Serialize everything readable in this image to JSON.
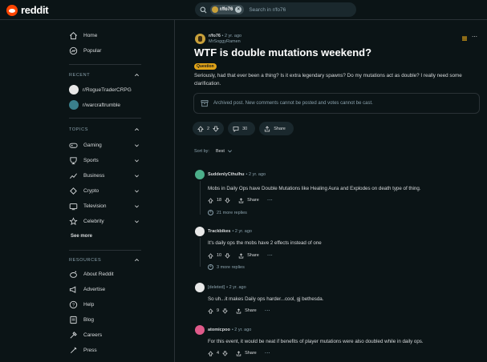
{
  "header": {
    "brand": "reddit",
    "search_chip": "r/fo76",
    "search_placeholder": "Search in r/fo76"
  },
  "sidebar": {
    "nav": [
      {
        "label": "Home",
        "icon": "home-icon"
      },
      {
        "label": "Popular",
        "icon": "popular-icon"
      }
    ],
    "recent_title": "RECENT",
    "recent": [
      {
        "label": "r/RogueTraderCRPG",
        "color": "#e8e8e8"
      },
      {
        "label": "r/warcraftrumble",
        "color": "#3a7f8c"
      }
    ],
    "topics_title": "TOPICS",
    "topics": [
      {
        "label": "Gaming",
        "icon": "gaming-icon"
      },
      {
        "label": "Sports",
        "icon": "sports-icon"
      },
      {
        "label": "Business",
        "icon": "business-icon"
      },
      {
        "label": "Crypto",
        "icon": "crypto-icon"
      },
      {
        "label": "Television",
        "icon": "television-icon"
      },
      {
        "label": "Celebrity",
        "icon": "celebrity-icon"
      }
    ],
    "see_more": "See more",
    "resources_title": "RESOURCES",
    "resources": [
      {
        "label": "About Reddit",
        "icon": "reddit-icon"
      },
      {
        "label": "Advertise",
        "icon": "advertise-icon"
      },
      {
        "label": "Help",
        "icon": "help-icon"
      },
      {
        "label": "Blog",
        "icon": "blog-icon"
      },
      {
        "label": "Careers",
        "icon": "careers-icon"
      },
      {
        "label": "Press",
        "icon": "press-icon"
      }
    ]
  },
  "post": {
    "subreddit": "r/fo76",
    "time": "• 2 yr. ago",
    "author": "MrSoggyRamen",
    "title": "WTF is double mutations weekend?",
    "flair": "Question",
    "body": "Seriously, had that ever been a thing? Is it extra legendary spawns? Do my mutations act as double? I really need some clarification.",
    "archived_note": "Archived post. New comments cannot be posted and votes cannot be cast.",
    "votes": "2",
    "comments": "30",
    "share": "Share"
  },
  "sort": {
    "label": "Sort by:",
    "value": "Best"
  },
  "comments": [
    {
      "author": "SuddenlyCthulhu",
      "time": "• 2 yr. ago",
      "text": "Mobs in Daily Ops have Double Mutations like Healing Aura and Explodes on death type of thing.",
      "votes": "18",
      "share": "Share",
      "more": "21 more replies",
      "avatar_color": "#4caf8a"
    },
    {
      "author": "Trackbikes",
      "time": "• 2 yr. ago",
      "text": "It's daily ops the mobs have 2 effects instead of one",
      "votes": "10",
      "share": "Share",
      "more": "3 more replies",
      "avatar_color": "#e8e8e8"
    },
    {
      "author": "[deleted]",
      "time": "• 2 yr. ago",
      "text": "So uh...it makes Daily ops harder...cool, gj bethesda.",
      "votes": "9",
      "share": "Share",
      "more": "",
      "avatar_color": "#e8e8e8"
    },
    {
      "author": "atomicpoo",
      "time": "• 2 yr. ago",
      "text": "For this event, it would be neat if benefits of player mutations were also doubled while in daily ops.",
      "votes": "4",
      "share": "Share",
      "more": "",
      "avatar_color": "#e05a8a"
    }
  ]
}
